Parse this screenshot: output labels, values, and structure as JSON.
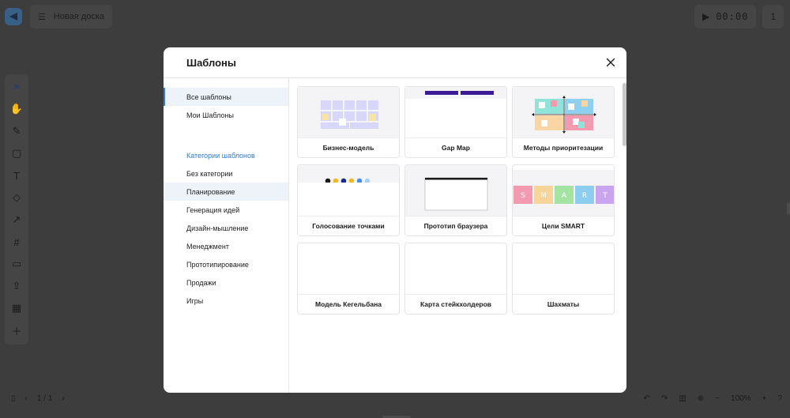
{
  "app": {
    "board_title": "Новая доска",
    "timer": "00:00",
    "participants": "1",
    "page_indicator": "1 / 1",
    "zoom": "100%"
  },
  "modal": {
    "title": "Шаблоны",
    "sidebar": {
      "top_items": [
        {
          "label": "Все шаблоны",
          "selected": true
        },
        {
          "label": "Мои Шаблоны",
          "selected": false
        }
      ],
      "categories_heading": "Категории шаблонов",
      "categories": [
        {
          "label": "Без категории"
        },
        {
          "label": "Планирование",
          "highlighted": true
        },
        {
          "label": "Генерация идей"
        },
        {
          "label": "Дизайн-мышление"
        },
        {
          "label": "Менеджмент"
        },
        {
          "label": "Прототипирование"
        },
        {
          "label": "Продажи"
        },
        {
          "label": "Игры"
        }
      ]
    },
    "templates": [
      {
        "label": "Бизнес-модель",
        "thumb": "business-model"
      },
      {
        "label": "Gap Map",
        "thumb": "gap-map"
      },
      {
        "label": "Методы приоритезации",
        "thumb": "prioritization-matrix"
      },
      {
        "label": "Голосование точками",
        "thumb": "dot-voting"
      },
      {
        "label": "Прототип браузера",
        "thumb": "browser-prototype"
      },
      {
        "label": "Цели SMART",
        "thumb": "smart-goals",
        "letters": [
          "S",
          "M",
          "A",
          "R",
          "T"
        ]
      },
      {
        "label": "Модель Кегельбана",
        "thumb": "blank"
      },
      {
        "label": "Карта стейкхолдеров",
        "thumb": "blank"
      },
      {
        "label": "Шахматы",
        "thumb": "blank"
      }
    ],
    "colors": {
      "accent": "#3a7bd5",
      "gap_map_bar": "#3b1c96",
      "smart": [
        "#f49ab0",
        "#f7d49a",
        "#a5e3a2",
        "#8ccdf0",
        "#c9a4ef"
      ],
      "dots": [
        "#1b1b1b",
        "#f1b81f",
        "#1c2a8c",
        "#f1b81f",
        "#4b8ee0",
        "#a8d1f5"
      ]
    }
  }
}
